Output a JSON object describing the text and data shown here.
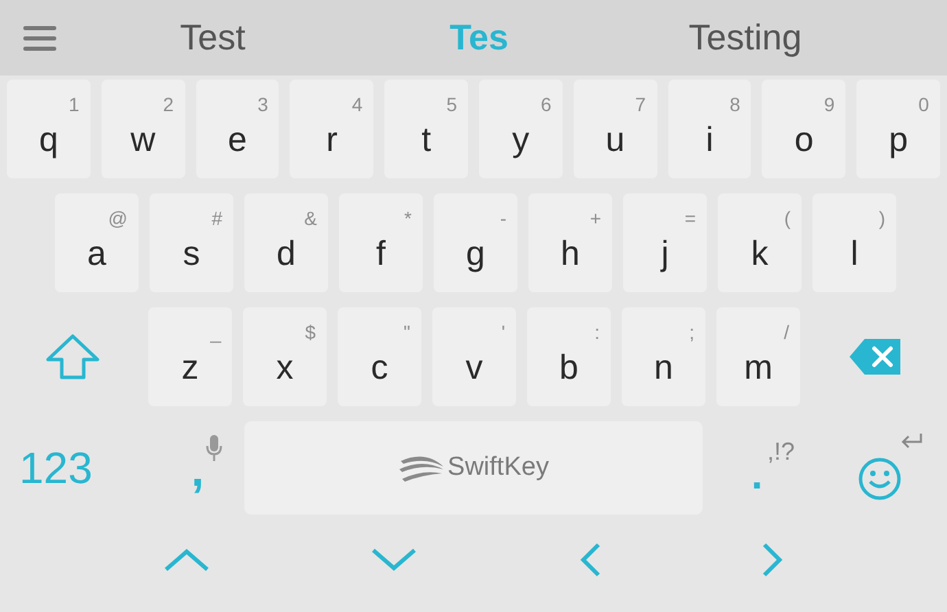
{
  "suggestions": [
    {
      "text": "Test",
      "selected": false
    },
    {
      "text": "Tes",
      "selected": true
    },
    {
      "text": "Testing",
      "selected": false
    }
  ],
  "rows": [
    [
      {
        "letter": "q",
        "hint": "1"
      },
      {
        "letter": "w",
        "hint": "2"
      },
      {
        "letter": "e",
        "hint": "3"
      },
      {
        "letter": "r",
        "hint": "4"
      },
      {
        "letter": "t",
        "hint": "5"
      },
      {
        "letter": "y",
        "hint": "6"
      },
      {
        "letter": "u",
        "hint": "7"
      },
      {
        "letter": "i",
        "hint": "8"
      },
      {
        "letter": "o",
        "hint": "9"
      },
      {
        "letter": "p",
        "hint": "0"
      }
    ],
    [
      {
        "letter": "a",
        "hint": "@"
      },
      {
        "letter": "s",
        "hint": "#"
      },
      {
        "letter": "d",
        "hint": "&"
      },
      {
        "letter": "f",
        "hint": "*"
      },
      {
        "letter": "g",
        "hint": "-"
      },
      {
        "letter": "h",
        "hint": "+"
      },
      {
        "letter": "j",
        "hint": "="
      },
      {
        "letter": "k",
        "hint": "("
      },
      {
        "letter": "l",
        "hint": ")"
      }
    ],
    [
      {
        "letter": "z",
        "hint": "_"
      },
      {
        "letter": "x",
        "hint": "$"
      },
      {
        "letter": "c",
        "hint": "\""
      },
      {
        "letter": "v",
        "hint": "'"
      },
      {
        "letter": "b",
        "hint": ":"
      },
      {
        "letter": "n",
        "hint": ";"
      },
      {
        "letter": "m",
        "hint": "/"
      }
    ]
  ],
  "bottom_row": {
    "numbers_key": "123",
    "comma_key": ",",
    "space_key": "SwiftKey",
    "period_key": ".",
    "period_hint": ",!?"
  }
}
